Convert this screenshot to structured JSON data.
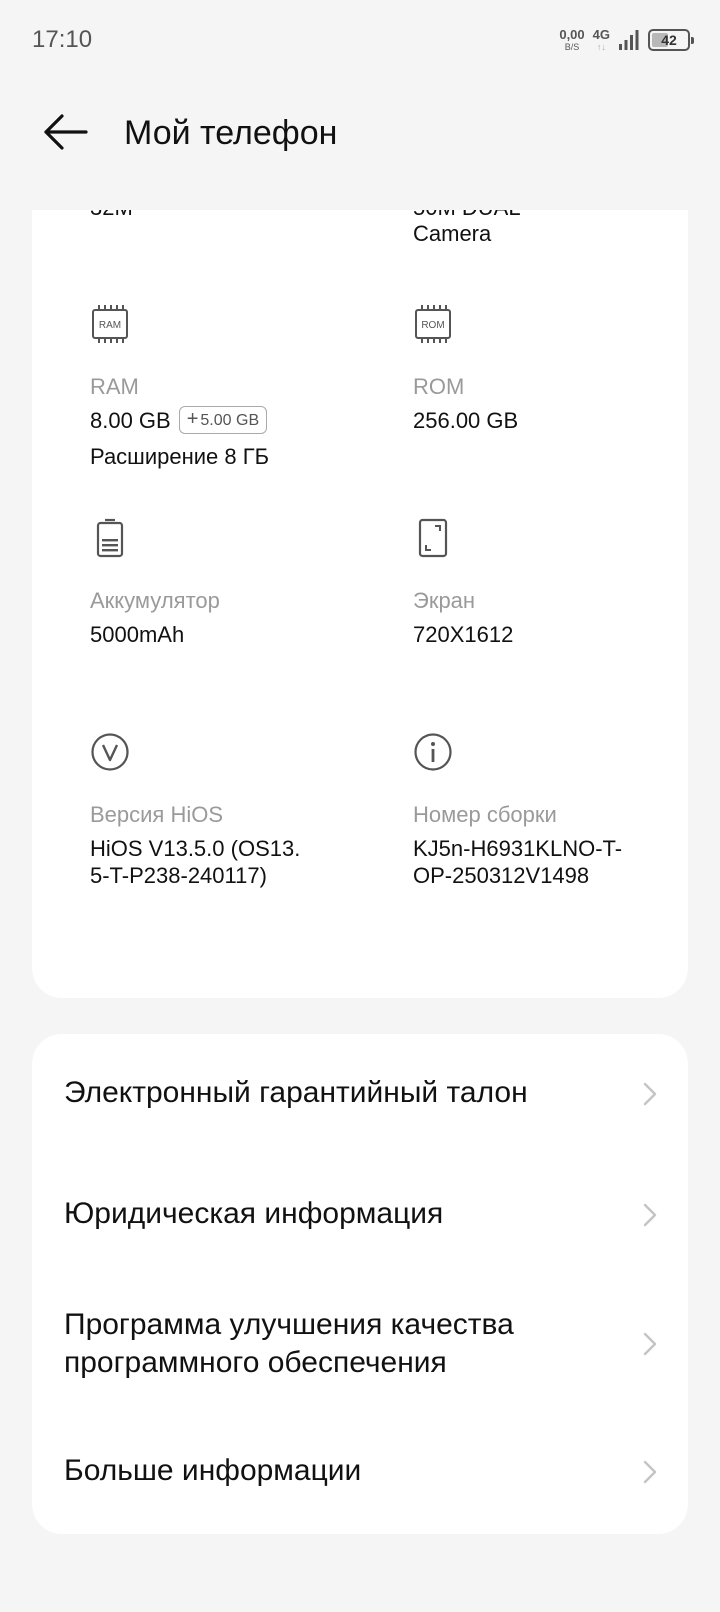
{
  "status_bar": {
    "time": "17:10",
    "net_speed_value": "0,00",
    "net_speed_unit": "B/S",
    "network_type": "4G",
    "network_arrows": "↑↓",
    "battery_level": "42",
    "battery_fraction": 0.42
  },
  "header": {
    "title": "Мой телефон",
    "back_icon": "arrow-left-icon"
  },
  "specs": {
    "cut_off": {
      "left_partial": "32M",
      "right_partial": "50M DUAL",
      "right_line2": "Camera"
    },
    "items": [
      {
        "icon": "ram-chip-icon",
        "icon_text": "RAM",
        "label": "RAM",
        "value": "8.00 GB",
        "badge": "5.00 GB",
        "value_line2": "Расширение 8 ГБ"
      },
      {
        "icon": "rom-chip-icon",
        "icon_text": "ROM",
        "label": "ROM",
        "value": "256.00 GB"
      },
      {
        "icon": "battery-icon",
        "label": "Аккумулятор",
        "value": "5000mAh"
      },
      {
        "icon": "screen-icon",
        "label": "Экран",
        "value": "720X1612"
      },
      {
        "icon": "version-icon",
        "label": "Версия HiOS",
        "value_lines": [
          "HiOS V13.5.0 (OS13.",
          "5-T-P238-240117)"
        ]
      },
      {
        "icon": "info-icon",
        "label": "Номер сборки",
        "value_lines": [
          "KJ5n-H6931KLNO-T-",
          "OP-250312V1498"
        ]
      }
    ]
  },
  "menu": {
    "items": [
      {
        "lines": [
          "Электронный гарантийный талон"
        ],
        "icon": "chevron-right-icon"
      },
      {
        "lines": [
          "Юридическая информация"
        ],
        "icon": "chevron-right-icon"
      },
      {
        "lines": [
          "Программа улучшения качества",
          "программного обеспечения"
        ],
        "icon": "chevron-right-icon"
      },
      {
        "lines": [
          "Больше информации"
        ],
        "icon": "chevron-right-icon"
      }
    ]
  },
  "colors": {
    "background": "#f5f5f5",
    "card": "#ffffff",
    "label_gray": "#9a9a9a",
    "icon_gray": "#555555",
    "chevron_gray": "#c4c4c4"
  }
}
